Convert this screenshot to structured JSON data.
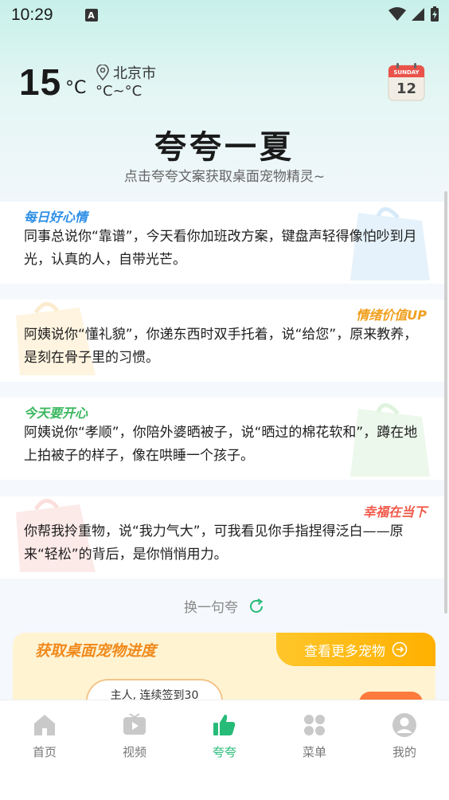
{
  "status": {
    "time": "10:29",
    "notif": "A"
  },
  "weather": {
    "temp": "15",
    "unit": "°C",
    "city": "北京市",
    "range": "°C~°C"
  },
  "calendar": {
    "weekday": "SUNDAY",
    "day": "12"
  },
  "header": {
    "title": "夸夸一夏",
    "subtitle": "点击夸夸文案获取桌面宠物精灵~"
  },
  "cards": [
    {
      "tag": "每日好心情",
      "tag_color": "#2f8fe6",
      "text": "同事总说你“靠谱”，今天看你加班改方案，键盘声轻得像怕吵到月光，认真的人，自带光芒。"
    },
    {
      "tag": "情绪价值UP",
      "tag_color": "#f0a020",
      "text": "阿姨说你“懂礼貌”，你递东西时双手托着，说“给您”，原来教养，是刻在骨子里的习惯。"
    },
    {
      "tag": "今天要开心",
      "tag_color": "#3cb860",
      "text": "阿姨说你“孝顺”，你陪外婆晒被子，说“晒过的棉花软和”，蹲在地上拍被子的样子，像在哄睡一个孩子。"
    },
    {
      "tag": "幸福在当下",
      "tag_color": "#f05a4a",
      "text": "你帮我拎重物，说“我力气大”，可我看见你手指捏得泛白——原来“轻松”的背后，是你悄悄用力。"
    }
  ],
  "refresh": {
    "label": "换一句夸"
  },
  "pet": {
    "title": "获取桌面宠物进度",
    "more": "查看更多宠物",
    "bubble": "主人, 连续签到30"
  },
  "tabs": [
    {
      "label": "首页"
    },
    {
      "label": "视频"
    },
    {
      "label": "夸夸"
    },
    {
      "label": "菜单"
    },
    {
      "label": "我的"
    }
  ]
}
